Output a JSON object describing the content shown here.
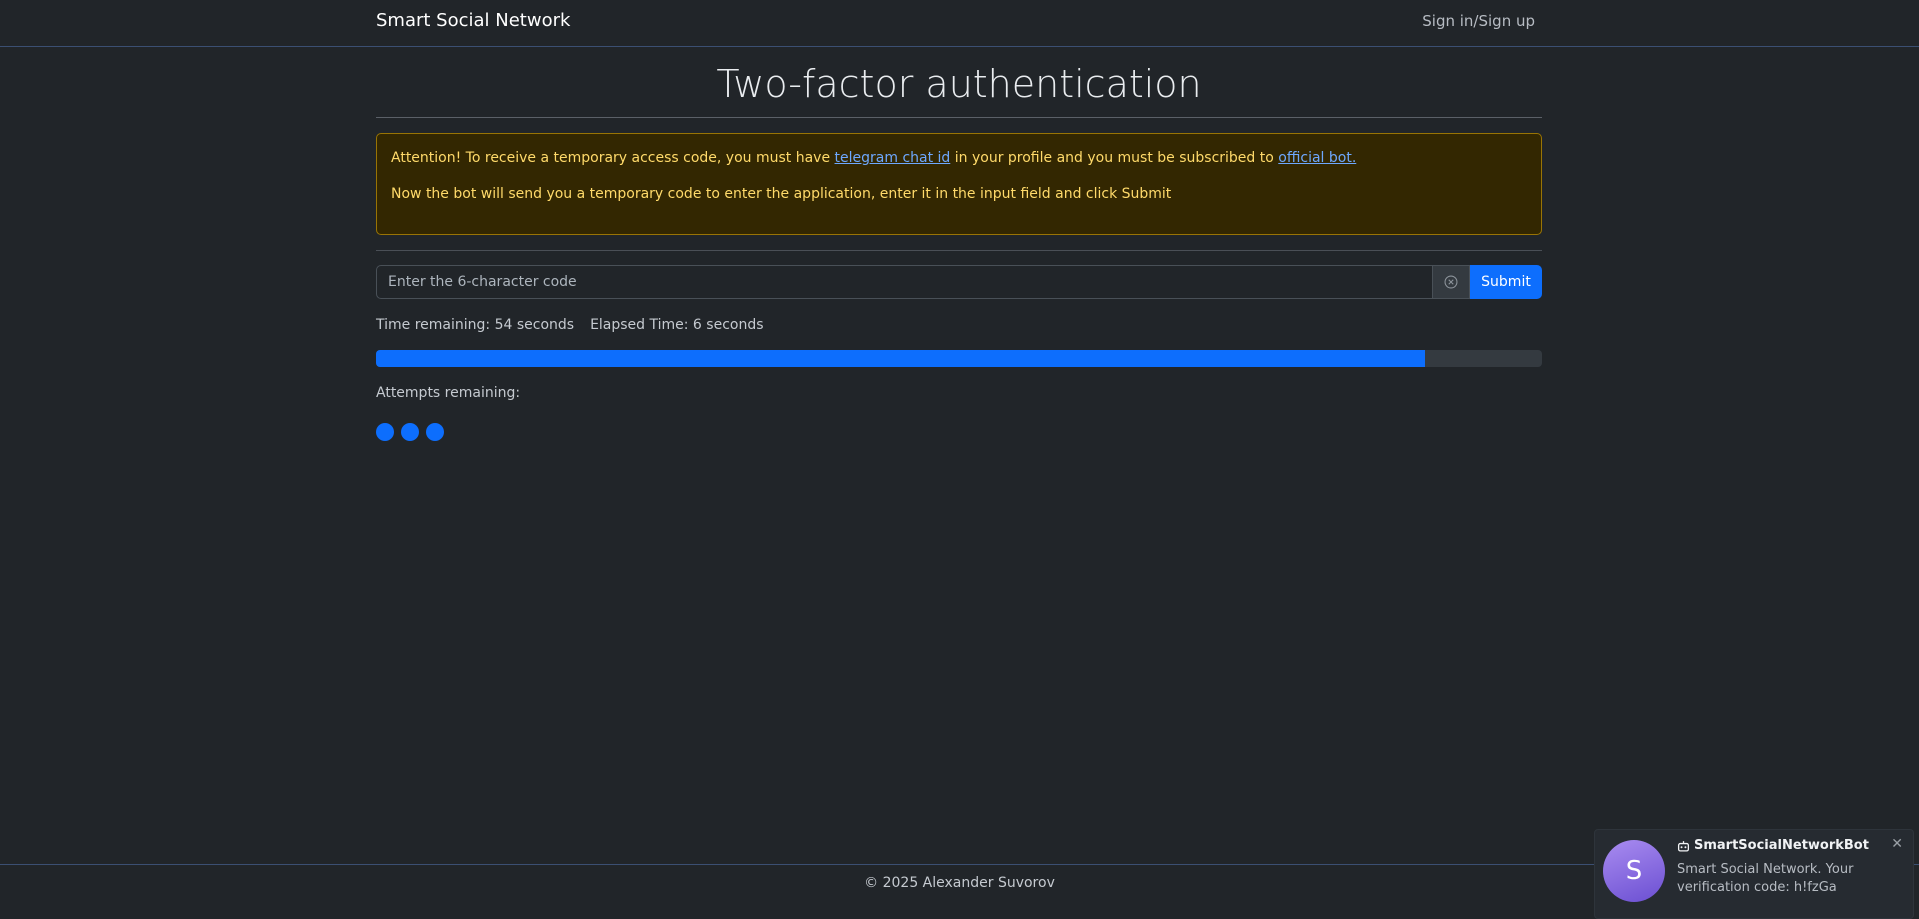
{
  "navbar": {
    "brand": "Smart Social Network",
    "signin": "Sign in/Sign up"
  },
  "page": {
    "title": "Two-factor authentication"
  },
  "alert": {
    "line1_before": "Attention! To receive a temporary access code, you must have ",
    "telegram_link": "telegram chat id",
    "line1_middle": " in your profile and you must be subscribed to ",
    "bot_link": "official bot.",
    "line2": "Now the bot will send you a temporary code to enter the application, enter it in the input field and click Submit"
  },
  "form": {
    "placeholder": "Enter the 6-character code",
    "value": "",
    "submit_label": "Submit",
    "clear_icon": "circle-x-icon"
  },
  "timer": {
    "remaining": "Time remaining: 54 seconds",
    "elapsed": "Elapsed Time: 6 seconds",
    "progress_percent": 90
  },
  "attempts": {
    "label": "Attempts remaining:",
    "count": 3
  },
  "footer": {
    "text": "© 2025 Alexander Suvorov"
  },
  "toast": {
    "avatar_letter": "S",
    "title": "SmartSocialNetworkBot",
    "title_icon": "robot-icon",
    "body": "Smart Social Network. Your verification code:  h!fzGa"
  },
  "colors": {
    "background": "#212529",
    "primary": "#0d6efd",
    "warning_bg": "#332701",
    "warning_text": "#ffda6a",
    "link": "#6ea8fe"
  }
}
